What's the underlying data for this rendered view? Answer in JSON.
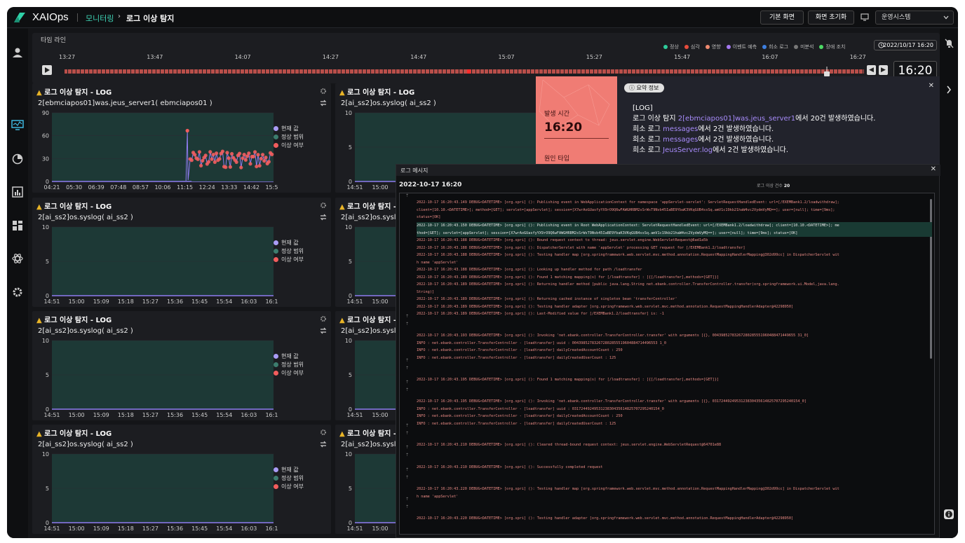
{
  "app": {
    "name": "XAIOps"
  },
  "breadcrumb": {
    "section": "모니터링",
    "page": "로그 이상 탐지"
  },
  "header": {
    "default_view": "기본 화면",
    "reset_view": "화면 초기화",
    "system_select": "운영시스템"
  },
  "timeline": {
    "title": "타임 라인",
    "legend": [
      {
        "label": "정상",
        "color": "#2ecc9a"
      },
      {
        "label": "심각",
        "color": "#e74c3c"
      },
      {
        "label": "영향",
        "color": "#f08a70"
      },
      {
        "label": "이벤트 예측",
        "color": "#a478f0"
      },
      {
        "label": "희소 로그",
        "color": "#3d7fe0"
      },
      {
        "label": "미분석",
        "color": "#777777"
      },
      {
        "label": "장애 조치",
        "color": "#4cd964"
      }
    ],
    "date": "2022/10/17 16:20",
    "ticks": [
      "13:27",
      "13:47",
      "14:07",
      "14:27",
      "14:47",
      "15:07",
      "15:27",
      "15:47",
      "16:07",
      "16:27"
    ],
    "current_time": "16:20"
  },
  "panel_legend": {
    "current": "현재 값",
    "normal_range": "정상 범위",
    "anomaly": "이상 여부"
  },
  "panels": [
    {
      "title": "로그 이상 탐지 - LOG",
      "subtitle": "2[ebmciapos01]was.jeus_server1( ebmciapos01 )",
      "y_ticks": [
        "90",
        "60",
        "30",
        "0"
      ],
      "x_ticks": [
        "04:21",
        "05:30",
        "06:39",
        "07:48",
        "08:57",
        "10:06",
        "11:15",
        "12:24",
        "13:33",
        "14:42",
        "15:51"
      ]
    },
    {
      "title": "로그 이상 탐지 - LOG",
      "subtitle": "2[ai_ss2]os.syslog( ai_ss2 )",
      "y_ticks": [
        "10",
        "5",
        "0"
      ],
      "x_ticks": [
        "14:51",
        "15:00",
        "15:09",
        "15:18",
        "15:27",
        "15:36",
        "15:45",
        "15:54",
        "16:03",
        "16:12"
      ]
    },
    {
      "title": "로그 이상 탐지 - LOG",
      "subtitle": "2[ai_ss2]os.syslog( ai_ss2 )",
      "y_ticks": [
        "10",
        "5",
        "0"
      ],
      "x_ticks": [
        "14:51",
        "15:00",
        "15:09",
        "15:18",
        "15:27",
        "15:36",
        "15:45",
        "15:54",
        "16:03",
        "16:12"
      ]
    },
    {
      "title": "로그 이상 탐지 - LOG",
      "subtitle": "2[ai_ss2]os.syslog( ai_ss2 )",
      "y_ticks": [
        "10",
        "5",
        "0"
      ],
      "x_ticks": [
        "14:51",
        "15:00",
        "15:09",
        "15:18",
        "15:27",
        "15:36",
        "15:45",
        "15:54",
        "16:03",
        "16:12"
      ]
    }
  ],
  "right_panels": [
    {
      "title": "로그 이상 탐지 - LOG",
      "subtitle": "2[ai_ss2]os.syslog( ai_ss2 )",
      "y_ticks": [
        "10",
        "5",
        "0"
      ],
      "x_ticks": [
        "14:51",
        "15:00"
      ]
    },
    {
      "title": "로그 이상 탐지 - LOG",
      "subtitle": "2[ai_ss2]os.syslog( ai_ss2 )",
      "y_ticks": [
        "10",
        "5",
        "0"
      ],
      "x_ticks": [
        "14:51",
        "15:00"
      ]
    },
    {
      "title": "로그 이상 탐지 - LOG",
      "subtitle": "2[ai_ss2]os.syslog( ai_ss2 )",
      "y_ticks": [
        "10",
        "5",
        "0"
      ],
      "x_ticks": [
        "14:51",
        "15:00"
      ]
    },
    {
      "title": "로그 이상 탐지 - LOG",
      "subtitle": "2[ai_ss2]os.syslog( ai_ss2 )",
      "y_ticks": [
        "10",
        "5",
        "0"
      ],
      "x_ticks": [
        "14:51",
        "15:00"
      ]
    }
  ],
  "summary": {
    "badge": "요약 정보",
    "occurred_label": "발생 시간",
    "occurred_time": "16:20",
    "cause_label": "원인 타입",
    "lines": [
      {
        "pre": "[LOG]",
        "hl": "",
        "post": ""
      },
      {
        "pre": "로그 이상 탐지 ",
        "hl": "2[ebmciapos01]was.jeus_server1",
        "post": "에서 20건 발생하였습니다."
      },
      {
        "pre": "희소 로그 ",
        "hl": "messages",
        "post": "에서 2건 발생하였습니다."
      },
      {
        "pre": "희소 로그 ",
        "hl": "messages",
        "post": "에서 2건 발생하였습니다."
      },
      {
        "pre": "희소 로그 ",
        "hl": "JeusServer.log",
        "post": "에서 2건 발생하였습니다."
      }
    ]
  },
  "log_window": {
    "title": "로그 메시지",
    "date": "2022-10-17 16:20",
    "count_label": "로그 이상 건수",
    "count": "20",
    "lines": [
      {
        "text": "2022-10-17 16:20:43.149 DEBUG<DATETIME> [org.spri] (): Publishing event in WebApplicationContext for namespace 'appServlet-servlet': ServletRequestHandledEvent: url=[/EXEMBank1.2/loadwithdraw];",
        "y": 8
      },
      {
        "text": "client=[10.10.<DATETIME>]; method=[GET]; servlet=[appServlet]; session=[X7wrAoGUasfyYX9rO9Q6wFAWGHRBM2sSrWsT9Nvb45IaBE9YbaK3VKqGUB4ssSq.amV1c19kb21haW4vc2VydmVyMQ==]; user=[null]; time=[9ms];",
        "y": 18.5
      },
      {
        "text": "status=[OK]",
        "y": 29
      },
      {
        "text": "2022-10-17 16:20:43.150 DEBUG<DATETIME> [org.spri] (): Publishing event in Root WebApplicationContext: ServletRequestHandledEvent: url=[/EXEMBank1.2/loadwithdraw]; client=[10.10.<DATETIME>]; me",
        "y": 41,
        "hl": true
      },
      {
        "text": "thod=[GET]; servlet=[appServlet]; session=[X7wrAoGUasfyYX9rO9Q6wFAWGHRBM2sSrWsT9Nvb45IaBE9YbaK3VKqGUB4ssSq.amV1c19kb21haW4vc2VydmVyMQ==]; user=[null]; time=[9ms]; status=[OK]",
        "y": 51.5,
        "hl": true
      },
      {
        "text": "2022-10-17 16:20:43.188 DEBUG<DATETIME> [org.spri] (): Bound request context to thread: jeus.servlet.engine.WebServletRequest@6ad1a5b",
        "y": 62
      },
      {
        "text": "2022-10-17 16:20:43.188 DEBUG<DATETIME> [org.spri] (): DispatcherServlet with name 'appServlet' processing GET request for [/EXEMBank1.2/loadtransfer]",
        "y": 72.5
      },
      {
        "text": "2022-10-17 16:20:43.188 DEBUG<DATETIME> [org.spri] (): Testing handler map [org.springframework.web.servlet.mvc.method.annotation.RequestMappingHandlerMapping@302d99cc] in DispatcherServlet wit",
        "y": 83
      },
      {
        "text": "h name 'appServlet'",
        "y": 93.5
      },
      {
        "text": "2022-10-17 16:20:43.188 DEBUG<DATETIME> [org.spri] (): Looking up handler method for path /loadtransfer",
        "y": 104
      },
      {
        "text": "2022-10-17 16:20:43.189 DEBUG<DATETIME> [org.spri] (): Found 1 matching mapping(s) for [/loadtransfer] : [{[/loadtransfer],methods=[GET]}]",
        "y": 114.5
      },
      {
        "text": "2022-10-17 16:20:43.189 DEBUG<DATETIME> [org.spri] (): Returning handler method [public java.lang.String net.ebank.controller.TransferController.transfer(org.springframework.ui.Model,java.lang.",
        "y": 125
      },
      {
        "text": "String)]",
        "y": 135.5
      },
      {
        "text": "2022-10-17 16:20:43.189 DEBUG<DATETIME> [org.spri] (): Returning cached instance of singleton bean 'transferController'",
        "y": 146
      },
      {
        "text": "2022-10-17 16:20:43.189 DEBUG<DATETIME> [org.spri] (): Testing handler adapter [org.springframework.web.servlet.mvc.method.annotation.RequestMappingHandlerAdapter@42298950]",
        "y": 156.5
      },
      {
        "text": "2022-10-17 16:20:43.189 DEBUG<DATETIME> [org.spri] (): Last-Modified value for [/EXEMBank1.2/loadtransfer] is: -1",
        "y": 167
      },
      {
        "text": "2022-10-17 16:20:43.193 DEBUG<DATETIME> [org.spri] (): Invoking 'net.ebank.controller.TransferController.transfer' with arguments [{}, 00439852783267280285551960488471449655 31_0]",
        "y": 198
      },
      {
        "text": "INFO : net.ebank.controller.TransferController - [loadtransfer] uuid : 004398527832672802855519604884714496553 1_0",
        "y": 208.5
      },
      {
        "text": "INFO : net.ebank.controller.TransferController - [loadtransfer] dailyCreatedAccountCount : 250",
        "y": 219
      },
      {
        "text": "INFO : net.ebank.controller.TransferController - [loadtransfer] dailyCreatedUserCount : 125",
        "y": 229.5
      },
      {
        "text": "2022-10-17 16:20:43.195 DEBUG<DATETIME> [org.spri] (): Found 1 matching mapping(s) for [/loadtransfer] : [{[/loadtransfer],methods=[GET]}]",
        "y": 261
      },
      {
        "text": "2022-10-17 16:20:43.195 DEBUG<DATETIME> [org.spri] (): Invoking 'net.ebank.controller.TransferController.transfer' with arguments [{}, 0317244924953123830435614825707295240154_0]",
        "y": 292
      },
      {
        "text": "INFO : net.ebank.controller.TransferController - [loadtransfer] uuid : 0317244924953123830435614825707295240154_0",
        "y": 302.5
      },
      {
        "text": "INFO : net.ebank.controller.TransferController - [loadtransfer] dailyCreatedAccountCount : 250",
        "y": 313
      },
      {
        "text": "INFO : net.ebank.controller.TransferController - [loadtransfer] dailyCreatedUserCount : 125",
        "y": 323.5
      },
      {
        "text": "2022-10-17 16:20:43.210 DEBUG<DATETIME> [org.spri] (): Cleared thread-bound request context: jeus.servlet.engine.WebServletRequest@64701e88",
        "y": 354
      },
      {
        "text": "2022-10-17 16:20:43.210 DEBUG<DATETIME> [org.spri] (): Successfully completed request",
        "y": 386
      },
      {
        "text": "2022-10-17 16:20:43.220 DEBUG<DATETIME> [org.spri] (): Testing handler map [org.springframework.web.servlet.mvc.method.annotation.RequestMappingHandlerMapping@302d99cc] in DispatcherServlet wit",
        "y": 417
      },
      {
        "text": "h name 'appServlet'",
        "y": 427.5
      },
      {
        "text": "2022-10-17 16:20:43.220 DEBUG<DATETIME> [org.spri] (): Testing handler adapter [org.springframework.web.servlet.mvc.method.annotation.RequestMappingHandlerAdapter@42298950]",
        "y": 459
      }
    ]
  }
}
